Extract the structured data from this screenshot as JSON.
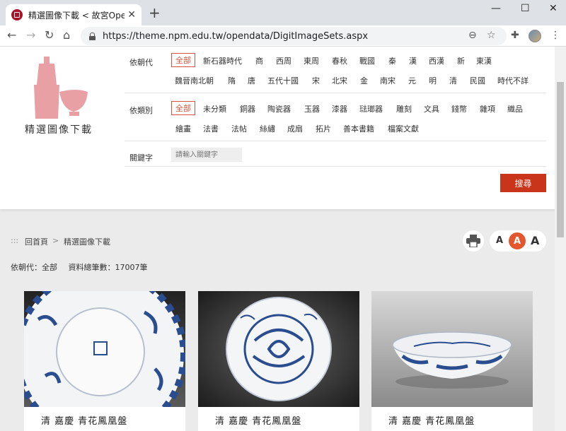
{
  "browser": {
    "tab_title": "精選圖像下載 < 故宮Open Data",
    "url": "https://theme.npm.edu.tw/opendata/DigitImageSets.aspx"
  },
  "site": {
    "title": "精選圖像下載"
  },
  "filters": {
    "dynasty_label": "依朝代",
    "dynasty_options": [
      "全部",
      "新石器時代",
      "商",
      "西周",
      "東周",
      "春秋",
      "戰國",
      "秦",
      "漢",
      "西漢",
      "新",
      "東漢",
      "魏晉南北朝",
      "隋",
      "唐",
      "五代十國",
      "宋",
      "北宋",
      "金",
      "南宋",
      "元",
      "明",
      "清",
      "民國",
      "時代不詳"
    ],
    "category_label": "依類別",
    "category_options": [
      "全部",
      "未分類",
      "銅器",
      "陶瓷器",
      "玉器",
      "漆器",
      "琺瑯器",
      "雕刻",
      "文具",
      "錢幣",
      "雜項",
      "織品",
      "繪畫",
      "法書",
      "法帖",
      "絲繡",
      "成扇",
      "拓片",
      "善本書籍",
      "檔案文獻"
    ],
    "keyword_label": "關鍵字",
    "keyword_placeholder": "請輸入關鍵字",
    "search_label": "搜尋"
  },
  "breadcrumb": {
    "marker": ":::",
    "home": "回首頁",
    "sep": ">",
    "current": "精選圖像下載"
  },
  "font_sizes": [
    "A",
    "A",
    "A"
  ],
  "meta": {
    "dynasty": "依朝代：全部",
    "count": "資料總筆數：17007筆"
  },
  "cards": [
    {
      "title": "清 嘉慶 青花鳳凰盤"
    },
    {
      "title": "清 嘉慶 青花鳳凰盤"
    },
    {
      "title": "清 嘉慶 青花鳳凰盤"
    }
  ],
  "icons": {
    "back": "arrow-left-icon",
    "forward": "arrow-right-icon",
    "reload": "reload-icon",
    "home": "home-icon",
    "zoom": "zoom-icon",
    "star": "star-icon",
    "extensions": "puzzle-icon",
    "menu": "kebab-menu-icon",
    "print": "printer-icon"
  },
  "colors": {
    "accent": "#c9351a",
    "active_option": "#d5543f",
    "logo_pink": "#e8a0a4"
  }
}
